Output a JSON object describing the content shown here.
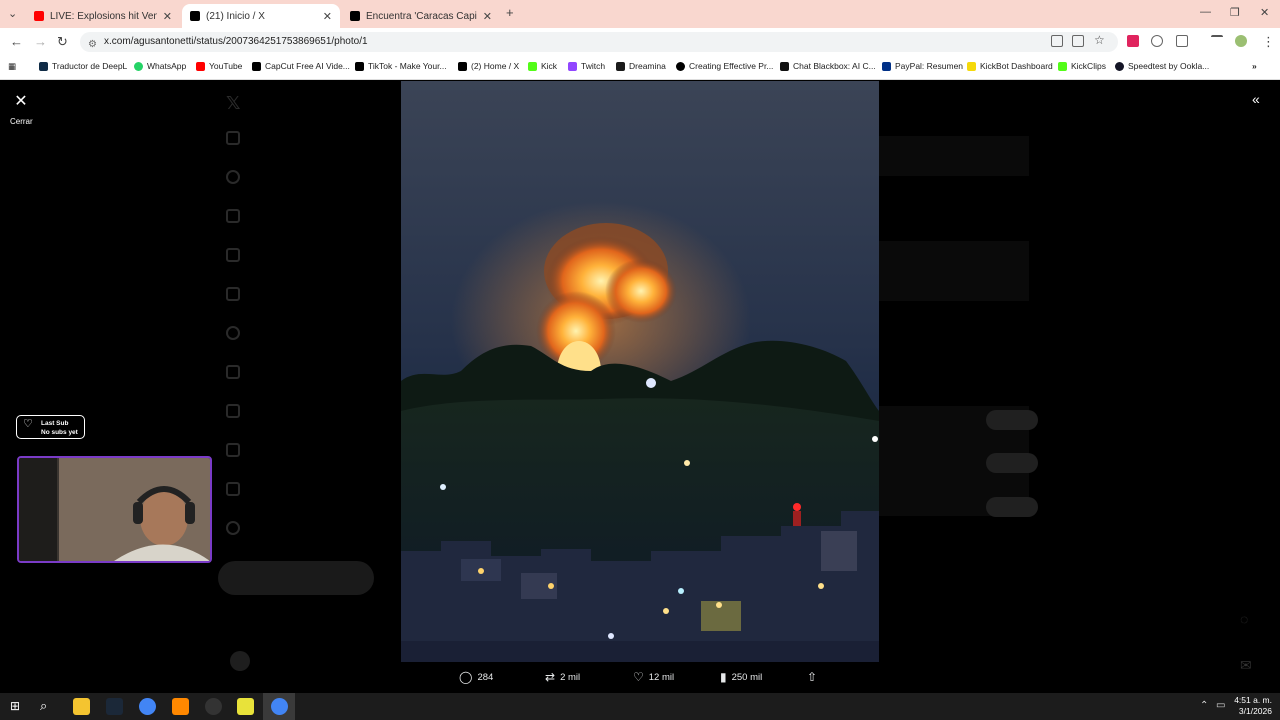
{
  "browser": {
    "tabs": [
      {
        "title": "LIVE: Explosions hit Venezuela's",
        "icon": "youtube-icon",
        "color": "#ff0000"
      },
      {
        "title": "(21) Inicio / X",
        "icon": "x-icon",
        "color": "#000000"
      },
      {
        "title": "Encuentra 'Caracas Capital Of V",
        "icon": "x-icon",
        "color": "#000000"
      }
    ],
    "url": "x.com/agusantonetti/status/2007364251753869651/photo/1",
    "bookmarks": [
      {
        "label": "Traductor de DeepL",
        "color": "#0f2b46"
      },
      {
        "label": "WhatsApp",
        "color": "#25d366"
      },
      {
        "label": "YouTube",
        "color": "#ff0000"
      },
      {
        "label": "CapCut Free AI Vide...",
        "color": "#000000"
      },
      {
        "label": "TikTok - Make Your...",
        "color": "#000000"
      },
      {
        "label": "(2) Home / X",
        "color": "#000000"
      },
      {
        "label": "Kick",
        "color": "#53fc18"
      },
      {
        "label": "Twitch",
        "color": "#9146ff"
      },
      {
        "label": "Dreamina",
        "color": "#1b1b1b"
      },
      {
        "label": "Creating Effective Pr...",
        "color": "#000000"
      },
      {
        "label": "Chat Blackbox: AI C...",
        "color": "#111111"
      },
      {
        "label": "PayPal: Resumen",
        "color": "#003087"
      },
      {
        "label": "KickBot Dashboard",
        "color": "#f5d90a"
      },
      {
        "label": "KickClips",
        "color": "#53fc18"
      },
      {
        "label": "Speedtest by Ookla...",
        "color": "#141526"
      }
    ]
  },
  "viewer": {
    "close_label": "Cerrar"
  },
  "overlay": {
    "last_sub_title": "Last Sub",
    "last_sub_value": "No subs yet"
  },
  "actions": {
    "replies": "284",
    "reposts": "2 mil",
    "likes": "12 mil",
    "views": "250 mil"
  },
  "taskbar": {
    "time": "4:51 a. m.",
    "date": "3/1/2026"
  },
  "colors": {
    "accent": "#1d9bf0",
    "tab_bar": "#f9d7cf"
  }
}
